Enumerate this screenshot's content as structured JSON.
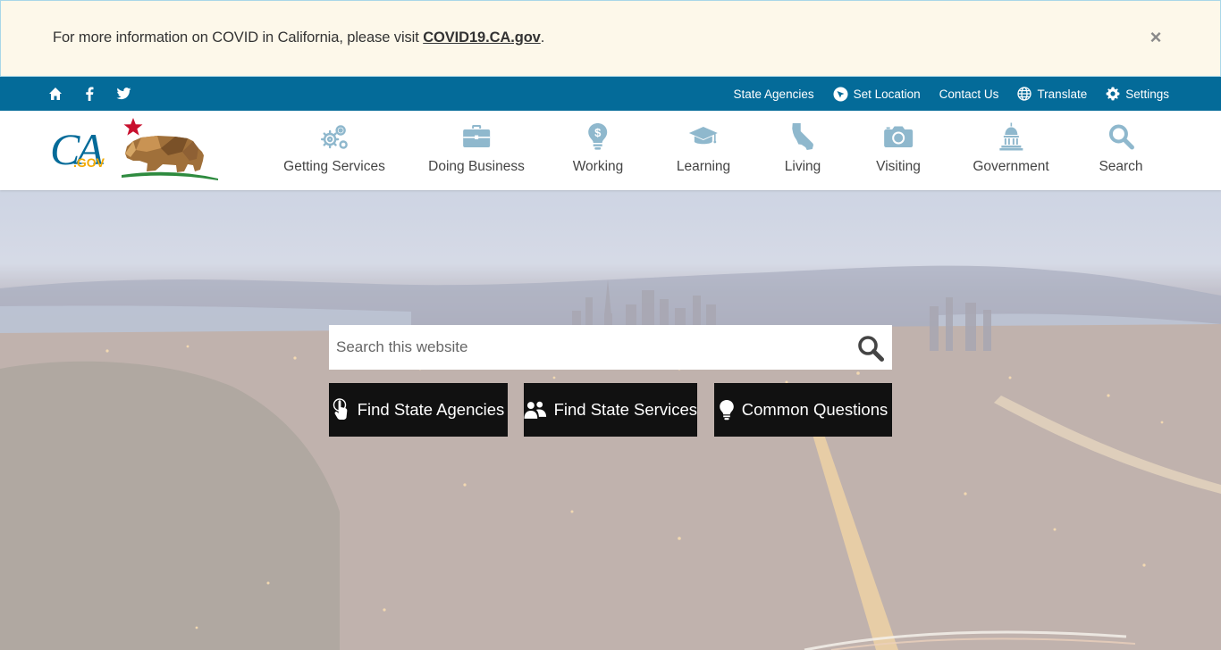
{
  "alert": {
    "text": "For more information on COVID in California, please visit ",
    "link": "COVID19.CA.gov",
    "suffix": ".",
    "close": "×"
  },
  "utility": {
    "left_icons": [
      "home-icon",
      "facebook-icon",
      "twitter-icon"
    ],
    "links": {
      "state_agencies": "State Agencies",
      "set_location": "Set Location",
      "contact_us": "Contact Us",
      "translate": "Translate",
      "settings": "Settings"
    }
  },
  "header": {
    "logo_text": "CA.GOV",
    "nav": {
      "getting_services": "Getting Services",
      "doing_business": "Doing Business",
      "working": "Working",
      "learning": "Learning",
      "living": "Living",
      "visiting": "Visiting",
      "government": "Government",
      "search": "Search"
    }
  },
  "hero": {
    "search_placeholder": "Search this website",
    "buttons": {
      "agencies": "Find State Agencies",
      "services": "Find State Services",
      "questions": "Common Questions"
    }
  },
  "colors": {
    "utility_bar": "#046b99",
    "nav_icon": "#8fb8cd",
    "alert_bg": "#fdf8ea",
    "button_bg": "#111111"
  }
}
